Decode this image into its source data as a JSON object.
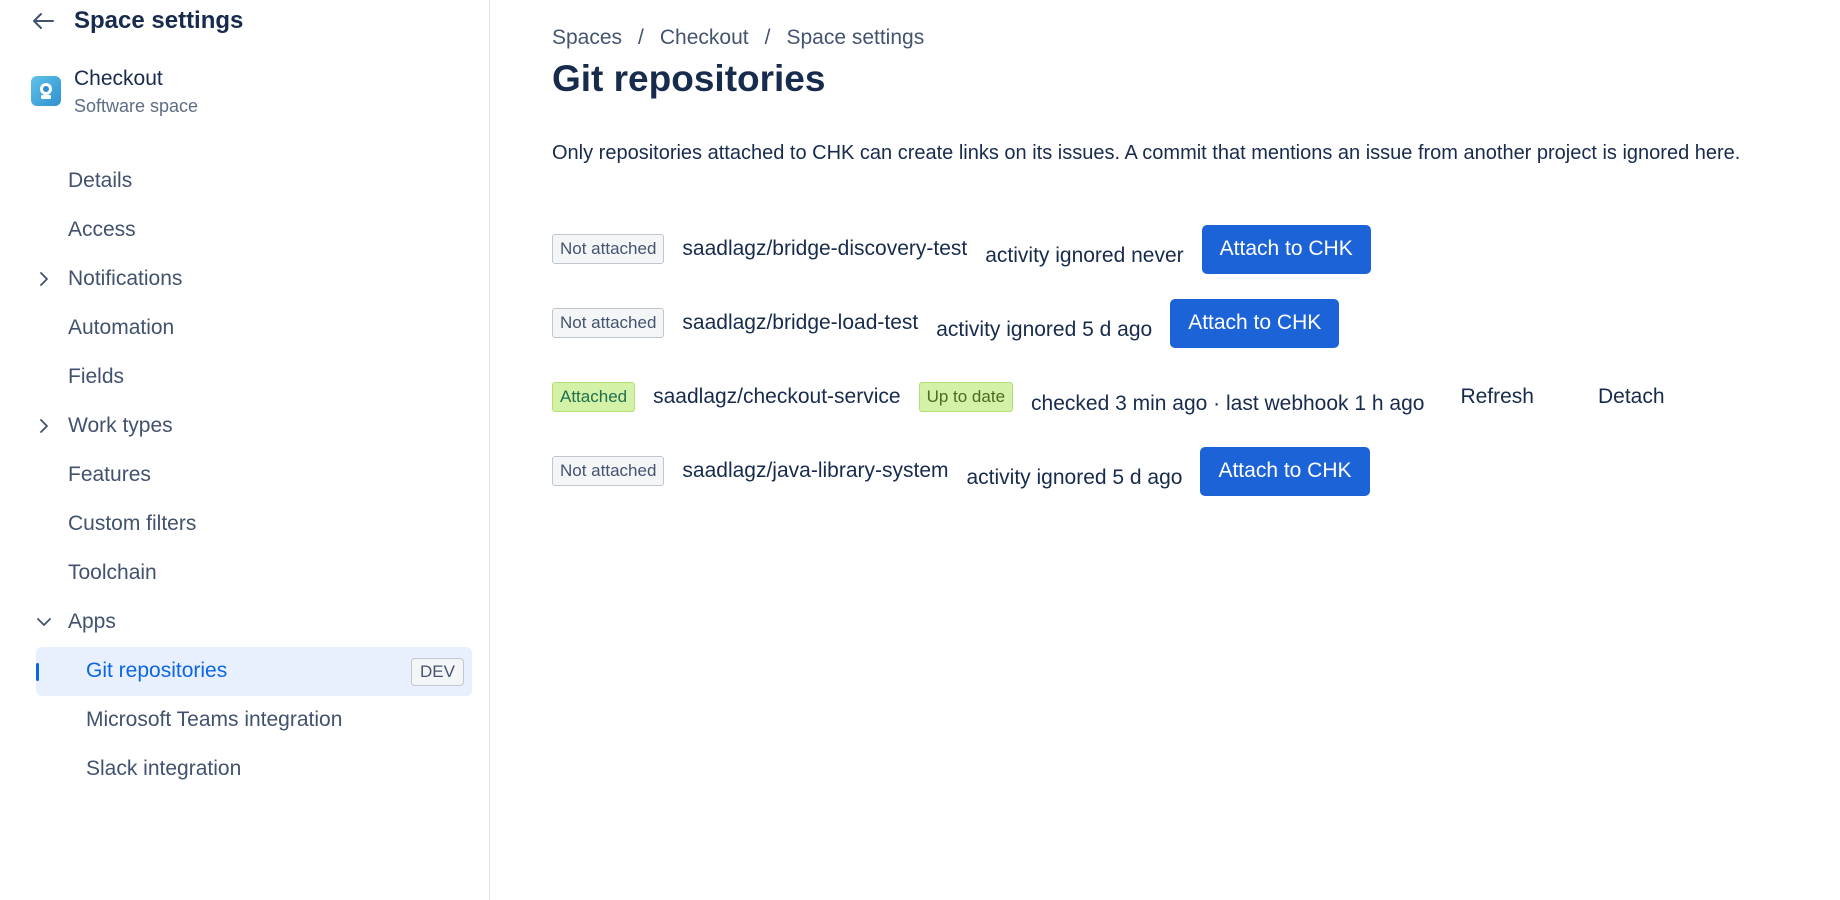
{
  "sidebar": {
    "title": "Space settings",
    "space": {
      "name": "Checkout",
      "type": "Software space"
    },
    "items": [
      {
        "label": "Details"
      },
      {
        "label": "Access"
      },
      {
        "label": "Notifications",
        "expandable": true,
        "expanded": false
      },
      {
        "label": "Automation"
      },
      {
        "label": "Fields"
      },
      {
        "label": "Work types",
        "expandable": true,
        "expanded": false
      },
      {
        "label": "Features"
      },
      {
        "label": "Custom filters"
      },
      {
        "label": "Toolchain"
      },
      {
        "label": "Apps",
        "expandable": true,
        "expanded": true
      }
    ],
    "sub_items": [
      {
        "label": "Git repositories",
        "badge": "DEV",
        "active": true
      },
      {
        "label": "Microsoft Teams integration"
      },
      {
        "label": "Slack integration"
      }
    ]
  },
  "breadcrumb": [
    "Spaces",
    "Checkout",
    "Space settings"
  ],
  "breadcrumb_separator": "/",
  "page_title": "Git repositories",
  "description": "Only repositories attached to CHK can create links on its issues. A commit that mentions an issue from another project is ignored here.",
  "repos": [
    {
      "status": "Not attached",
      "name": "saadlagz/bridge-discovery-test",
      "meta": "activity ignored never",
      "action": "Attach to CHK"
    },
    {
      "status": "Not attached",
      "name": "saadlagz/bridge-load-test",
      "meta": "activity ignored 5 d ago",
      "action": "Attach to CHK"
    },
    {
      "status": "Attached",
      "name": "saadlagz/checkout-service",
      "sync_status": "Up to date",
      "meta": "checked 3 min ago · last webhook 1 h ago",
      "refresh": "Refresh",
      "detach": "Detach"
    },
    {
      "status": "Not attached",
      "name": "saadlagz/java-library-system",
      "meta": "activity ignored 5 d ago",
      "action": "Attach to CHK"
    }
  ],
  "colors": {
    "primary": "#1d63d8",
    "active_nav_bg": "#e9f0fd",
    "attached_badge_bg": "#d3f1a7",
    "sidebar_border": "#dfe1e6"
  }
}
